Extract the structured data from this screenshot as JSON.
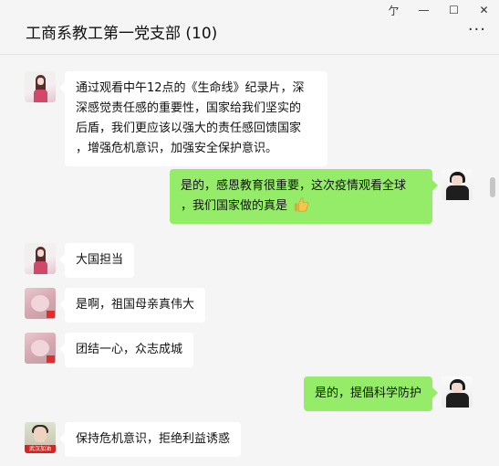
{
  "window": {
    "title": "工商系教工第一党支部 (10)",
    "controls": {
      "pin": "亇",
      "minimize": "—",
      "maximize": "☐",
      "close": "✕"
    },
    "more": "···"
  },
  "messages": [
    {
      "side": "left",
      "lines": [
        "通过观看中午12点的《生命线》纪录片，深",
        "深感觉责任感的重要性，国家给我们坚实的",
        "后盾，我们更应该以强大的责任感回馈国家",
        "，增强危机意识，加强安全保护意识。"
      ]
    },
    {
      "side": "right",
      "lines": [
        "是的，感恩教育很重要，这次疫情观看全球",
        "，我们国家做的真是"
      ],
      "emoji": "thumbs-up-icon"
    },
    {
      "side": "left",
      "text": "大国担当"
    },
    {
      "side": "left",
      "text": "是啊，祖国母亲真伟大"
    },
    {
      "side": "left",
      "text": "团结一心，众志成城"
    },
    {
      "side": "right",
      "text": "是的，提倡科学防护"
    },
    {
      "side": "left",
      "text": "保持危机意识，拒绝利益诱惑"
    }
  ],
  "avatar_badges": {
    "green_avatar": "武汉加油"
  },
  "colors": {
    "bubble_self": "#95ec69",
    "bubble_other": "#ffffff",
    "background": "#f5f5f5"
  }
}
